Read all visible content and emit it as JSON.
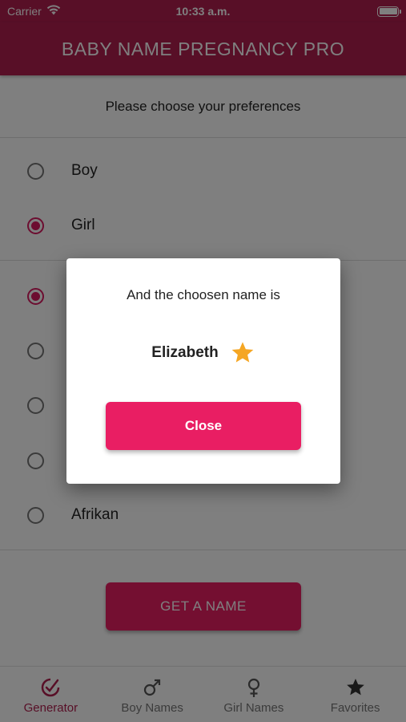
{
  "status_bar": {
    "carrier": "Carrier",
    "time": "10:33 a.m.",
    "wifi_icon": "wifi-icon",
    "battery_icon": "battery-icon"
  },
  "app_bar": {
    "title": "BABY NAME PREGNANCY PRO"
  },
  "preferences": {
    "heading": "Please choose your preferences",
    "gender_options": [
      {
        "label": "Boy",
        "selected": false
      },
      {
        "label": "Girl",
        "selected": true
      }
    ],
    "origin_options": [
      {
        "label": "",
        "selected": true
      },
      {
        "label": "",
        "selected": false
      },
      {
        "label": "",
        "selected": false
      },
      {
        "label": "",
        "selected": false
      },
      {
        "label": "Afrikan",
        "selected": false
      }
    ]
  },
  "get_name_button": {
    "label": "GET A NAME"
  },
  "bottom_nav": {
    "items": [
      {
        "label": "Generator",
        "icon": "generator-icon",
        "active": true
      },
      {
        "label": "Boy Names",
        "icon": "male-symbol-icon",
        "active": false
      },
      {
        "label": "Girl Names",
        "icon": "female-symbol-icon",
        "active": false
      },
      {
        "label": "Favorites",
        "icon": "star-icon",
        "active": false
      }
    ]
  },
  "dialog": {
    "title": "And the choosen name is",
    "name": "Elizabeth",
    "favorite_icon": "star-icon",
    "close_label": "Close"
  },
  "colors": {
    "primary": "#b01e4e",
    "accent": "#e91e63",
    "star": "#f5a623",
    "overlay": "rgba(0,0,0,0.5)"
  }
}
